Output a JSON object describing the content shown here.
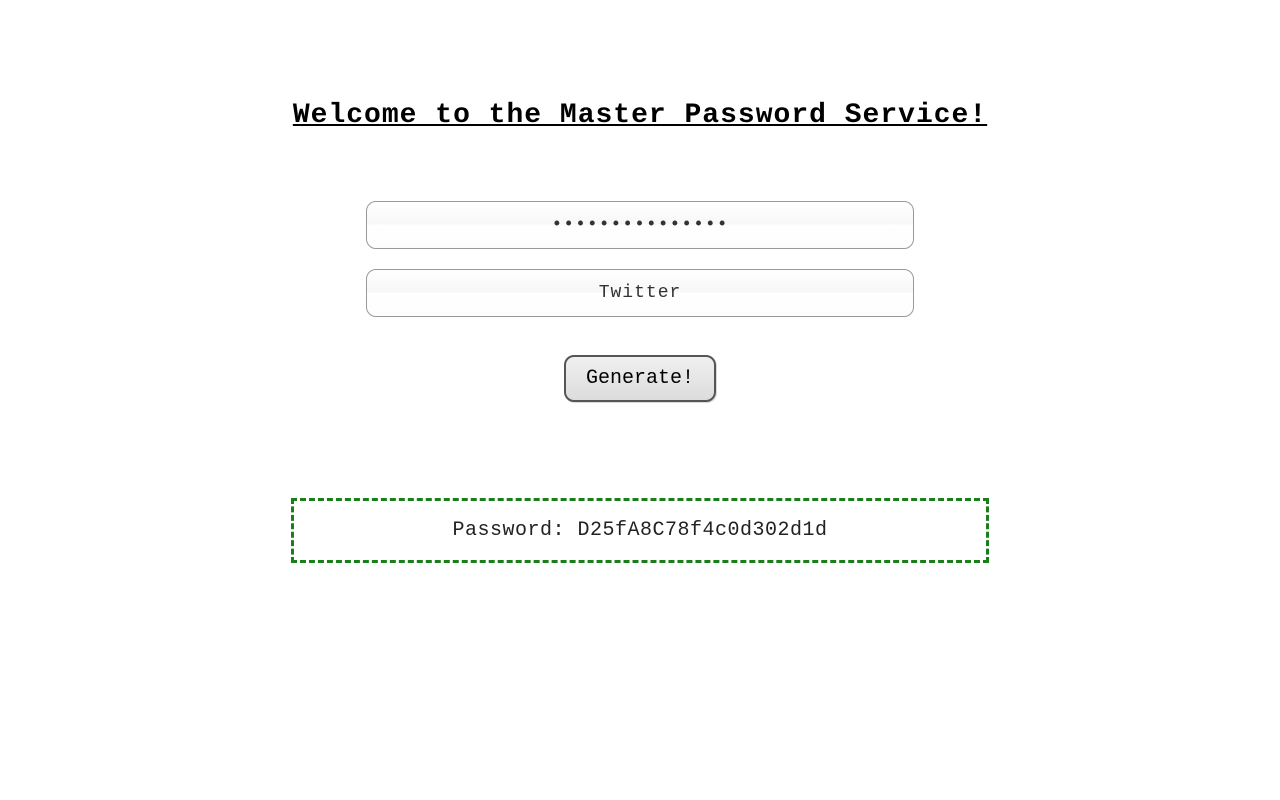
{
  "title": "Welcome to the Master Password Service!",
  "form": {
    "master_password_value": "...............",
    "service_value": "Twitter",
    "generate_label": "Generate!"
  },
  "output": {
    "label": "Password: ",
    "value": "D25fA8C78f4c0d302d1d"
  }
}
